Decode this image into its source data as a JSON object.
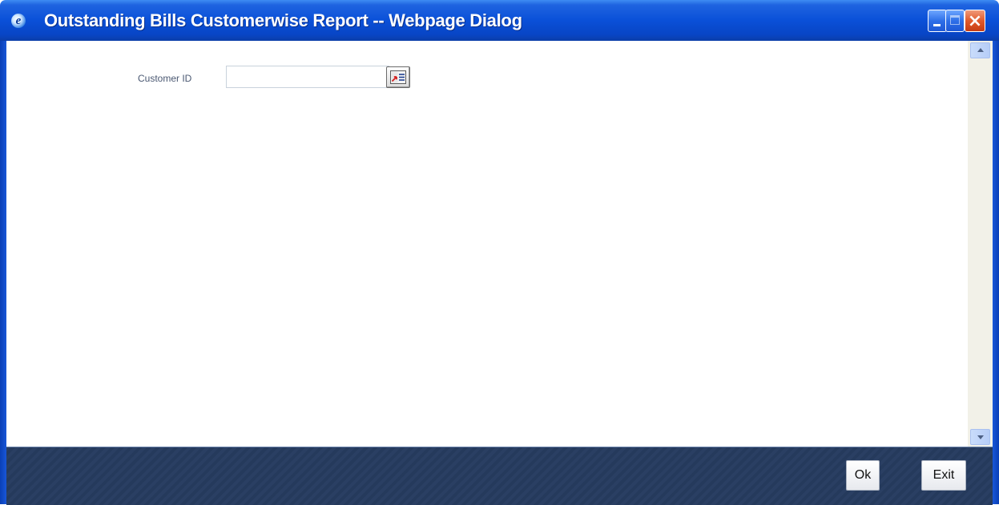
{
  "window": {
    "title": "Outstanding Bills Customerwise Report -- Webpage Dialog",
    "icon": "ie-icon",
    "controls": [
      "minimize-icon",
      "maximize-icon",
      "close-icon"
    ]
  },
  "form": {
    "customer_id_label": "Customer ID",
    "customer_id_value": "",
    "customer_id_placeholder": "",
    "lov_icon": "list-of-values-icon"
  },
  "footer": {
    "ok_label": "Ok",
    "exit_label": "Exit"
  },
  "colors": {
    "titlebar": "#0a50d8",
    "footer": "#2a3f63",
    "label_text": "#4a5872",
    "close_button": "#e15a2b"
  }
}
